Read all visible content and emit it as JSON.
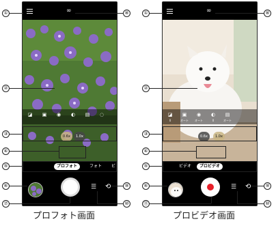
{
  "callouts": [
    "①",
    "②",
    "③",
    "④",
    "⑤",
    "⑥",
    "⑦",
    "⑧",
    "⑨",
    "⑩",
    "⑪"
  ],
  "screens": [
    {
      "caption": "プロフォト画面",
      "settings_labels": [
        "",
        "",
        "",
        "",
        "",
        ""
      ],
      "zoom": [
        "0.6x",
        "1.0x"
      ],
      "mode_tabs": [
        "プロフォト",
        "フォト",
        "ビ"
      ],
      "active_mode": "プロフォト",
      "icons": {
        "menu": "menu-icon",
        "mode": "infinity-icon",
        "adjust": "adjust-icon",
        "switch": "camera-switch-icon"
      }
    },
    {
      "caption": "プロビデオ画面",
      "settings_labels": [
        "0",
        "オート",
        "オート",
        "0",
        "オート"
      ],
      "zoom": [
        "0.6x",
        "1.0x"
      ],
      "mode_tabs": [
        "ビデオ",
        "プロビデオ"
      ],
      "active_mode": "プロビデオ",
      "icons": {
        "menu": "menu-icon",
        "mode": "infinity-icon",
        "adjust": "adjust-icon",
        "switch": "camera-switch-icon",
        "record": "record-icon"
      }
    }
  ],
  "colors": {
    "record_red": "#e8202a",
    "flower_purple": "#8a6bc4",
    "leaf_green": "#4f7a34"
  }
}
